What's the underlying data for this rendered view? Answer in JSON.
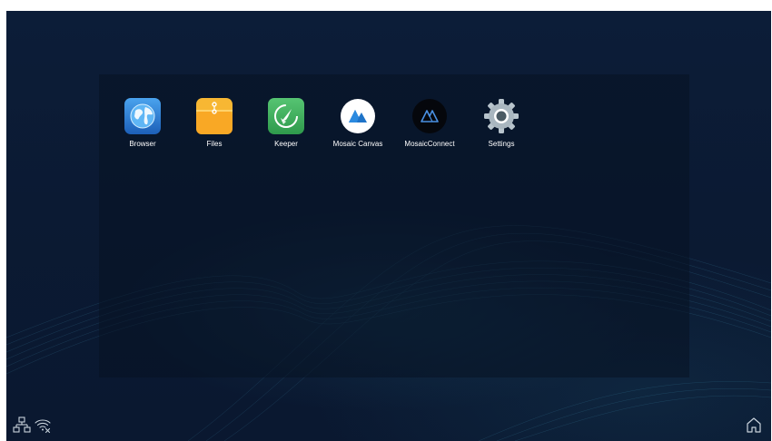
{
  "apps": [
    {
      "label": "Browser",
      "icon": "globe-icon"
    },
    {
      "label": "Files",
      "icon": "folder-icon"
    },
    {
      "label": "Keeper",
      "icon": "broom-icon"
    },
    {
      "label": "Mosaic Canvas",
      "icon": "mosaic-canvas-icon"
    },
    {
      "label": "MosaicConnect",
      "icon": "mosaic-connect-icon"
    },
    {
      "label": "Settings",
      "icon": "gear-icon"
    }
  ],
  "status_bar": {
    "left_icons": [
      "ethernet-icon",
      "wifi-disconnected-icon"
    ],
    "right_icons": [
      "home-icon"
    ]
  },
  "colors": {
    "background": "#0b1a33",
    "label_text": "#ffffff",
    "browser_blue": "#2f7fd8",
    "files_yellow": "#f7b733",
    "keeper_green": "#3fae5c",
    "mosaic_blue": "#1e73c8"
  }
}
